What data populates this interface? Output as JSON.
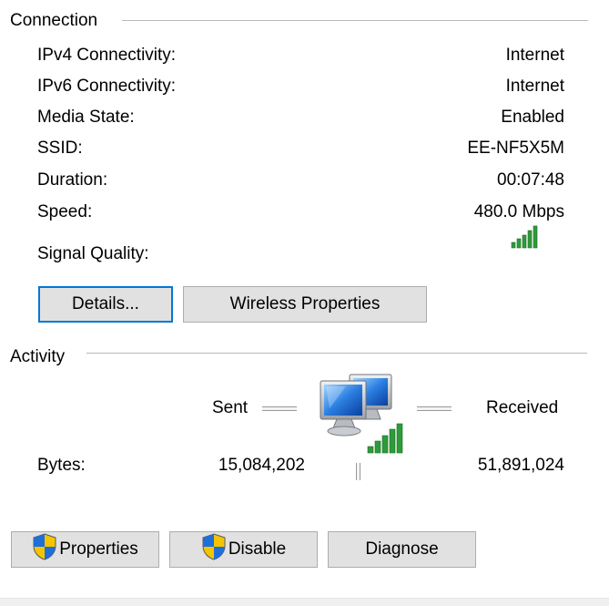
{
  "connection": {
    "title": "Connection",
    "rows": [
      {
        "label": "IPv4 Connectivity:",
        "value": "Internet"
      },
      {
        "label": "IPv6 Connectivity:",
        "value": "Internet"
      },
      {
        "label": "Media State:",
        "value": "Enabled"
      },
      {
        "label": "SSID:",
        "value": "EE-NF5X5M"
      },
      {
        "label": "Duration:",
        "value": "00:07:48"
      },
      {
        "label": "Speed:",
        "value": "480.0 Mbps"
      }
    ],
    "signal_label": "Signal Quality:",
    "signal_bars": 5,
    "details_label": "Details...",
    "wireless_props_label": "Wireless Properties"
  },
  "activity": {
    "title": "Activity",
    "sent_label": "Sent",
    "received_label": "Received",
    "bytes_label": "Bytes:",
    "bytes_sent": "15,084,202",
    "bytes_received": "51,891,024"
  },
  "buttons": {
    "properties_label": "Properties",
    "disable_label": "Disable",
    "diagnose_label": "Diagnose"
  },
  "colors": {
    "accent": "#0078d7",
    "signal": "#2e9b3a"
  }
}
